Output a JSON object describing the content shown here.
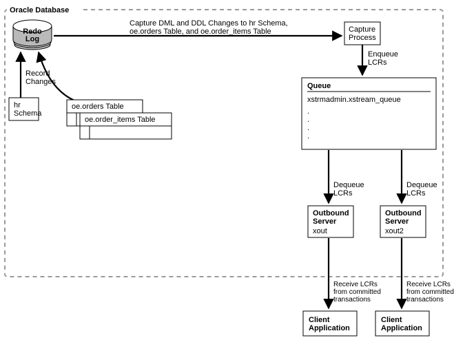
{
  "container_label": "Oracle Database",
  "redo_log": "Redo\nLog",
  "record_changes": "Record\nChanges",
  "hr_schema": "hr\nSchema",
  "orders_table": "oe.orders Table",
  "order_items_table": "oe.order_items Table",
  "capture_desc": "Capture DML and DDL Changes to hr Schema,\noe.orders Table, and oe.order_items Table",
  "capture_process": "Capture\nProcess",
  "enqueue": "Enqueue\nLCRs",
  "queue_title": "Queue",
  "queue_name": "xstrmadmin.xstream_queue",
  "dequeue": "Dequeue\nLCRs",
  "outbound_title": "Outbound\nServer",
  "outbound1_name": "xout",
  "outbound2_name": "xout2",
  "receive": "Receive LCRs\nfrom committed\ntransactions",
  "client_app": "Client\nApplication"
}
